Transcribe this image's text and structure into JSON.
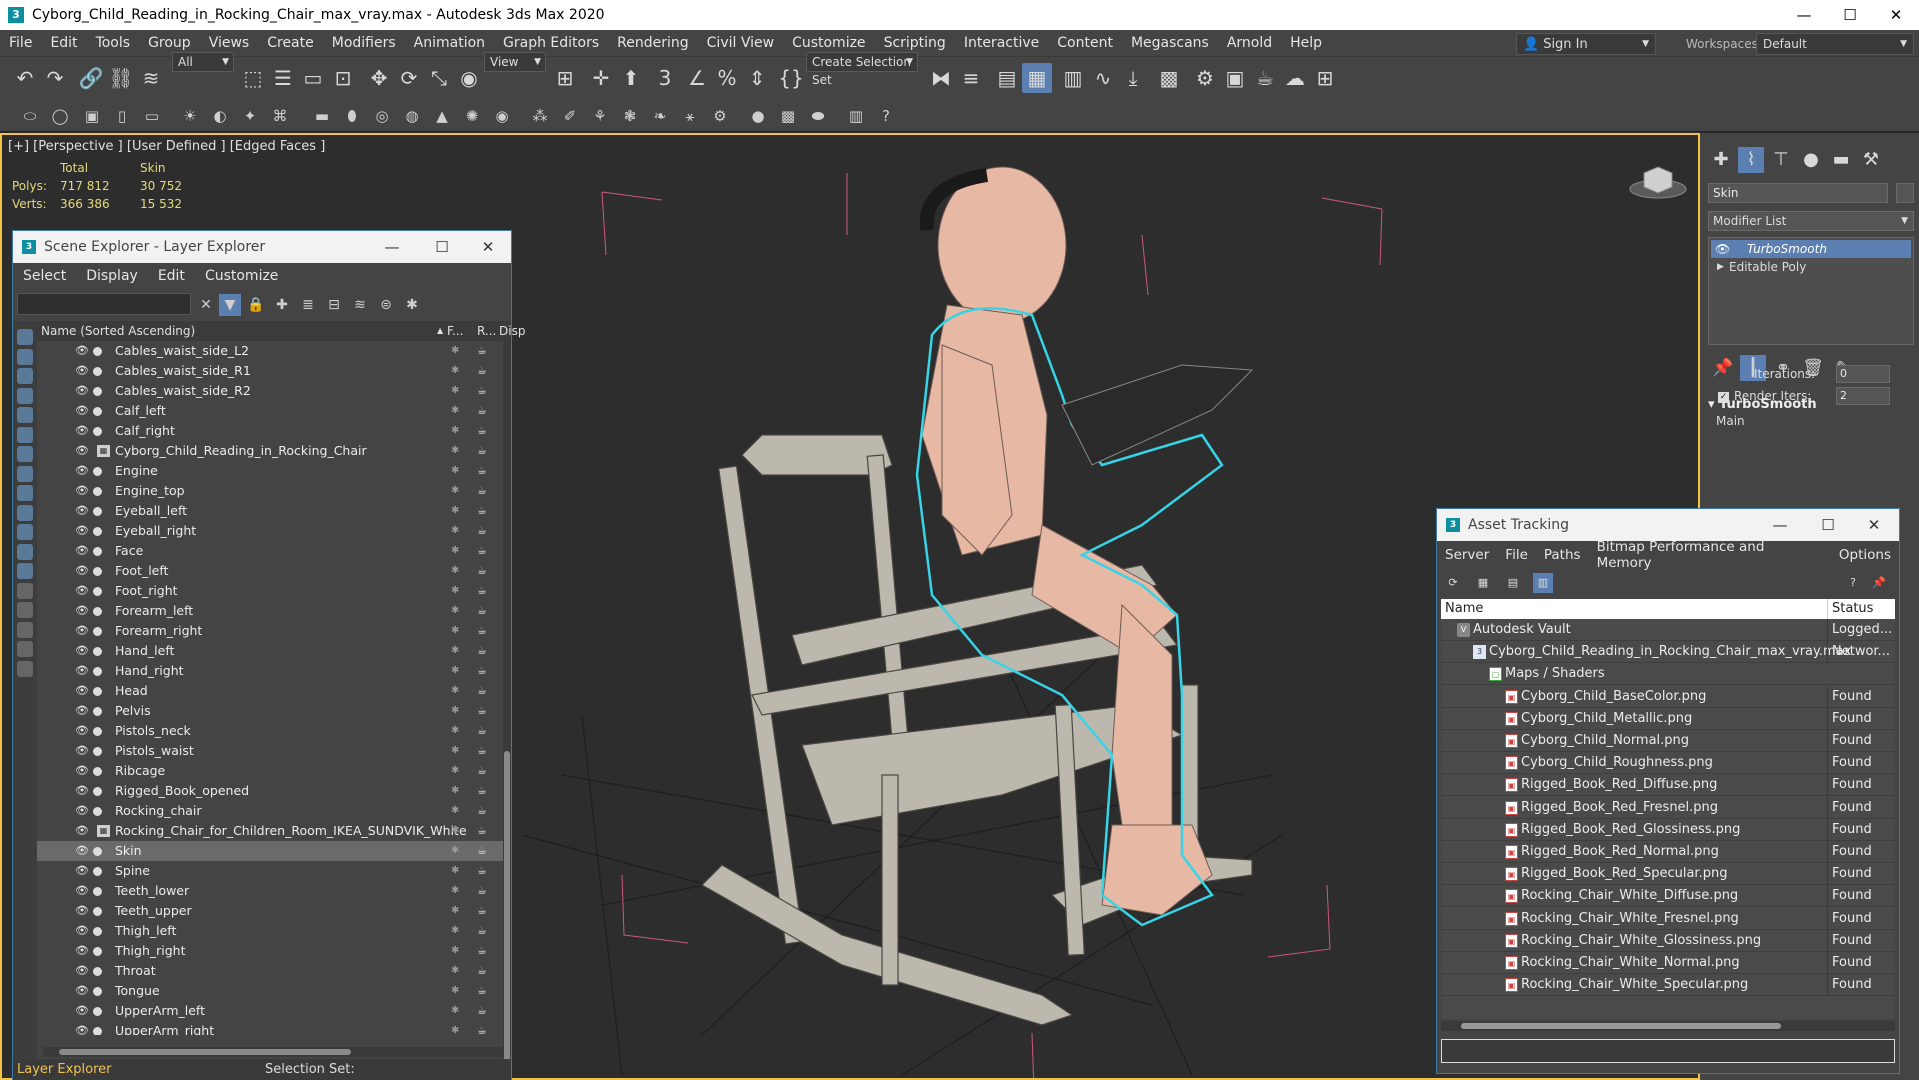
{
  "window": {
    "title": "Cyborg_Child_Reading_in_Rocking_Chair_max_vray.max - Autodesk 3ds Max 2020",
    "app_icon": "3"
  },
  "menu": [
    "File",
    "Edit",
    "Tools",
    "Group",
    "Views",
    "Create",
    "Modifiers",
    "Animation",
    "Graph Editors",
    "Rendering",
    "Civil View",
    "Customize",
    "Scripting",
    "Interactive",
    "Content",
    "Megascans",
    "Arnold",
    "Help"
  ],
  "signin": {
    "label": "Sign In"
  },
  "workspaces": {
    "label": "Workspaces:",
    "value": "Default"
  },
  "toolbar": {
    "filter_value": "All",
    "refcoord_value": "View",
    "selection_set_placeholder": "Create Selection Set"
  },
  "viewport": {
    "label": "[+] [Perspective ] [User Defined ] [Edged Faces ]",
    "stats": {
      "header": [
        "",
        "Total",
        "Skin"
      ],
      "rows": [
        [
          "Polys:",
          "717 812",
          "30 752"
        ],
        [
          "Verts:",
          "366 386",
          "15 532"
        ]
      ]
    }
  },
  "scene_explorer": {
    "title": "Scene Explorer - Layer Explorer",
    "app_icon": "3",
    "menu": [
      "Select",
      "Display",
      "Edit",
      "Customize"
    ],
    "column_name": "Name (Sorted Ascending)",
    "column_sort_marker": "▲",
    "column_freeze": "F...",
    "column_render": "R...",
    "column_display": "Disp",
    "items": [
      {
        "name": "Cables_waist_side_L2",
        "group": false,
        "selected": false
      },
      {
        "name": "Cables_waist_side_R1",
        "group": false,
        "selected": false
      },
      {
        "name": "Cables_waist_side_R2",
        "group": false,
        "selected": false
      },
      {
        "name": "Calf_left",
        "group": false,
        "selected": false
      },
      {
        "name": "Calf_right",
        "group": false,
        "selected": false
      },
      {
        "name": "Cyborg_Child_Reading_in_Rocking_Chair",
        "group": true,
        "selected": false
      },
      {
        "name": "Engine",
        "group": false,
        "selected": false
      },
      {
        "name": "Engine_top",
        "group": false,
        "selected": false
      },
      {
        "name": "Eyeball_left",
        "group": false,
        "selected": false
      },
      {
        "name": "Eyeball_right",
        "group": false,
        "selected": false
      },
      {
        "name": "Face",
        "group": false,
        "selected": false
      },
      {
        "name": "Foot_left",
        "group": false,
        "selected": false
      },
      {
        "name": "Foot_right",
        "group": false,
        "selected": false
      },
      {
        "name": "Forearm_left",
        "group": false,
        "selected": false
      },
      {
        "name": "Forearm_right",
        "group": false,
        "selected": false
      },
      {
        "name": "Hand_left",
        "group": false,
        "selected": false
      },
      {
        "name": "Hand_right",
        "group": false,
        "selected": false
      },
      {
        "name": "Head",
        "group": false,
        "selected": false
      },
      {
        "name": "Pelvis",
        "group": false,
        "selected": false
      },
      {
        "name": "Pistols_neck",
        "group": false,
        "selected": false
      },
      {
        "name": "Pistols_waist",
        "group": false,
        "selected": false
      },
      {
        "name": "Ribcage",
        "group": false,
        "selected": false
      },
      {
        "name": "Rigged_Book_opened",
        "group": false,
        "selected": false
      },
      {
        "name": "Rocking_chair",
        "group": false,
        "selected": false
      },
      {
        "name": "Rocking_Chair_for_Children_Room_IKEA_SUNDVIK_White",
        "group": true,
        "selected": false
      },
      {
        "name": "Skin",
        "group": false,
        "selected": true
      },
      {
        "name": "Spine",
        "group": false,
        "selected": false
      },
      {
        "name": "Teeth_lower",
        "group": false,
        "selected": false
      },
      {
        "name": "Teeth_upper",
        "group": false,
        "selected": false
      },
      {
        "name": "Thigh_left",
        "group": false,
        "selected": false
      },
      {
        "name": "Thigh_right",
        "group": false,
        "selected": false
      },
      {
        "name": "Throat",
        "group": false,
        "selected": false
      },
      {
        "name": "Tongue",
        "group": false,
        "selected": false
      },
      {
        "name": "UpperArm_left",
        "group": false,
        "selected": false
      },
      {
        "name": "UpperArm_right",
        "group": false,
        "selected": false
      }
    ],
    "bottom_explorer": "Layer Explorer",
    "bottom_selection_set": "Selection Set:"
  },
  "command_panel": {
    "object_name": "Skin",
    "modifier_list": "Modifier List",
    "stack": [
      "TurboSmooth",
      "Editable Poly"
    ],
    "rollout_title": "TurboSmooth",
    "rollout_group": "Main",
    "iterations_label": "Iterations:",
    "iterations_value": "0",
    "render_iters_label": "Render Iters:",
    "render_iters_value": "2"
  },
  "asset_tracking": {
    "title": "Asset Tracking",
    "app_icon": "3",
    "menu": [
      "Server",
      "File",
      "Paths",
      "Bitmap Performance and Memory",
      "Options"
    ],
    "col_name": "Name",
    "col_status": "Status",
    "rows": [
      {
        "name": "Autodesk Vault",
        "status": "Logged...",
        "level": 0,
        "icon": "vault-icon"
      },
      {
        "name": "Cyborg_Child_Reading_in_Rocking_Chair_max_vray.max",
        "status": "Networ...",
        "level": 1,
        "icon": "max-file-icon"
      },
      {
        "name": "Maps / Shaders",
        "status": "",
        "level": 2,
        "icon": "folder-icon"
      },
      {
        "name": "Cyborg_Child_BaseColor.png",
        "status": "Found",
        "level": 3,
        "icon": "png-icon"
      },
      {
        "name": "Cyborg_Child_Metallic.png",
        "status": "Found",
        "level": 3,
        "icon": "png-icon"
      },
      {
        "name": "Cyborg_Child_Normal.png",
        "status": "Found",
        "level": 3,
        "icon": "png-icon"
      },
      {
        "name": "Cyborg_Child_Roughness.png",
        "status": "Found",
        "level": 3,
        "icon": "png-icon"
      },
      {
        "name": "Rigged_Book_Red_Diffuse.png",
        "status": "Found",
        "level": 3,
        "icon": "png-icon"
      },
      {
        "name": "Rigged_Book_Red_Fresnel.png",
        "status": "Found",
        "level": 3,
        "icon": "png-icon"
      },
      {
        "name": "Rigged_Book_Red_Glossiness.png",
        "status": "Found",
        "level": 3,
        "icon": "png-icon"
      },
      {
        "name": "Rigged_Book_Red_Normal.png",
        "status": "Found",
        "level": 3,
        "icon": "png-icon"
      },
      {
        "name": "Rigged_Book_Red_Specular.png",
        "status": "Found",
        "level": 3,
        "icon": "png-icon"
      },
      {
        "name": "Rocking_Chair_White_Diffuse.png",
        "status": "Found",
        "level": 3,
        "icon": "png-icon"
      },
      {
        "name": "Rocking_Chair_White_Fresnel.png",
        "status": "Found",
        "level": 3,
        "icon": "png-icon"
      },
      {
        "name": "Rocking_Chair_White_Glossiness.png",
        "status": "Found",
        "level": 3,
        "icon": "png-icon"
      },
      {
        "name": "Rocking_Chair_White_Normal.png",
        "status": "Found",
        "level": 3,
        "icon": "png-icon"
      },
      {
        "name": "Rocking_Chair_White_Specular.png",
        "status": "Found",
        "level": 3,
        "icon": "png-icon"
      }
    ]
  },
  "colors": {
    "viewport_border": "#f5c344",
    "selection_blue": "#5b7fb0",
    "selected_outline": "#37d3e6",
    "stats_yellow": "#e4d97b"
  }
}
